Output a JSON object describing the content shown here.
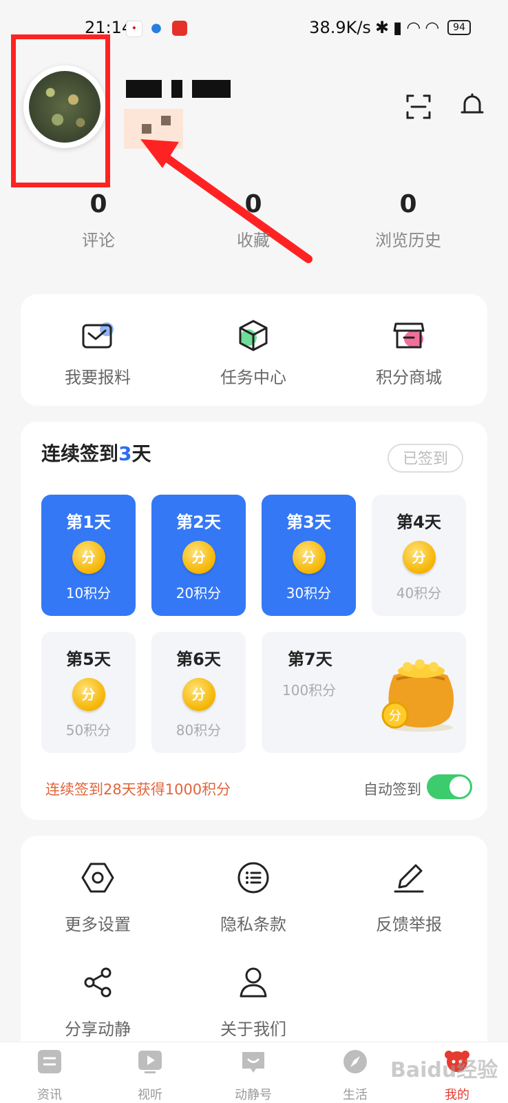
{
  "status_bar": {
    "time": "21:14",
    "network_speed": "38.9K/s",
    "battery": "94"
  },
  "stats": [
    {
      "value": "0",
      "label": "评论"
    },
    {
      "value": "0",
      "label": "收藏"
    },
    {
      "value": "0",
      "label": "浏览历史"
    }
  ],
  "quick_actions": [
    {
      "label": "我要报料",
      "icon": "mail-icon"
    },
    {
      "label": "任务中心",
      "icon": "box-icon"
    },
    {
      "label": "积分商城",
      "icon": "store-icon"
    }
  ],
  "signin": {
    "title_prefix": "连续签到",
    "days_count": "3",
    "title_suffix": "天",
    "signed_label": "已签到",
    "coin_label": "分",
    "days": [
      {
        "title": "第1天",
        "points": "10积分",
        "done": true
      },
      {
        "title": "第2天",
        "points": "20积分",
        "done": true
      },
      {
        "title": "第3天",
        "points": "30积分",
        "done": true
      },
      {
        "title": "第4天",
        "points": "40积分",
        "done": false
      },
      {
        "title": "第5天",
        "points": "50积分",
        "done": false
      },
      {
        "title": "第6天",
        "points": "80积分",
        "done": false
      },
      {
        "title": "第7天",
        "points": "100积分",
        "done": false
      }
    ],
    "streak_reward": "连续签到28天获得1000积分",
    "auto_signin_label": "自动签到",
    "auto_signin_on": true
  },
  "settings": [
    {
      "label": "更多设置",
      "icon": "hexagon-settings-icon"
    },
    {
      "label": "隐私条款",
      "icon": "list-icon"
    },
    {
      "label": "反馈举报",
      "icon": "pen-icon"
    },
    {
      "label": "分享动静",
      "icon": "share-icon"
    },
    {
      "label": "关于我们",
      "icon": "person-icon"
    }
  ],
  "bottom_nav": [
    {
      "label": "资讯",
      "icon": "news-icon",
      "active": false
    },
    {
      "label": "视听",
      "icon": "video-icon",
      "active": false
    },
    {
      "label": "动静号",
      "icon": "chat-icon",
      "active": false
    },
    {
      "label": "生活",
      "icon": "compass-icon",
      "active": false
    },
    {
      "label": "我的",
      "icon": "mascot-icon",
      "active": true
    }
  ],
  "watermark": "Baidu经验",
  "colors": {
    "accent_blue": "#3478f6",
    "highlight_red": "#f22222",
    "toggle_green": "#3ccc6d",
    "streak_orange": "#e0653c"
  }
}
